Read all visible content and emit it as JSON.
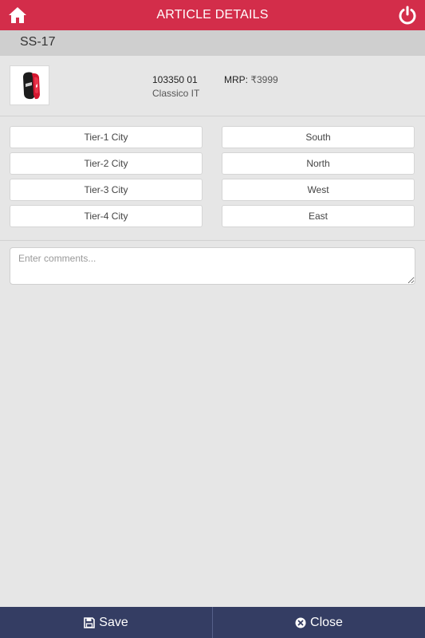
{
  "header": {
    "title": "ARTICLE DETAILS",
    "home_icon": "home-icon",
    "power_icon": "power-icon",
    "color": "#d32d4a"
  },
  "season": "SS-17",
  "article": {
    "code": "103350 01",
    "name": "Classico IT",
    "mrp_label": "MRP:",
    "mrp_value": "₹3999",
    "image_icon": "shin-guard-image"
  },
  "city_tiers": [
    "Tier-1 City",
    "Tier-2 City",
    "Tier-3 City",
    "Tier-4 City"
  ],
  "regions": [
    "South",
    "North",
    "West",
    "East"
  ],
  "comments": {
    "placeholder": "Enter comments...",
    "value": ""
  },
  "footer": {
    "save_label": "Save",
    "close_label": "Close",
    "save_icon": "floppy-disk-icon",
    "close_icon": "close-circle-icon",
    "color": "#343d63"
  }
}
